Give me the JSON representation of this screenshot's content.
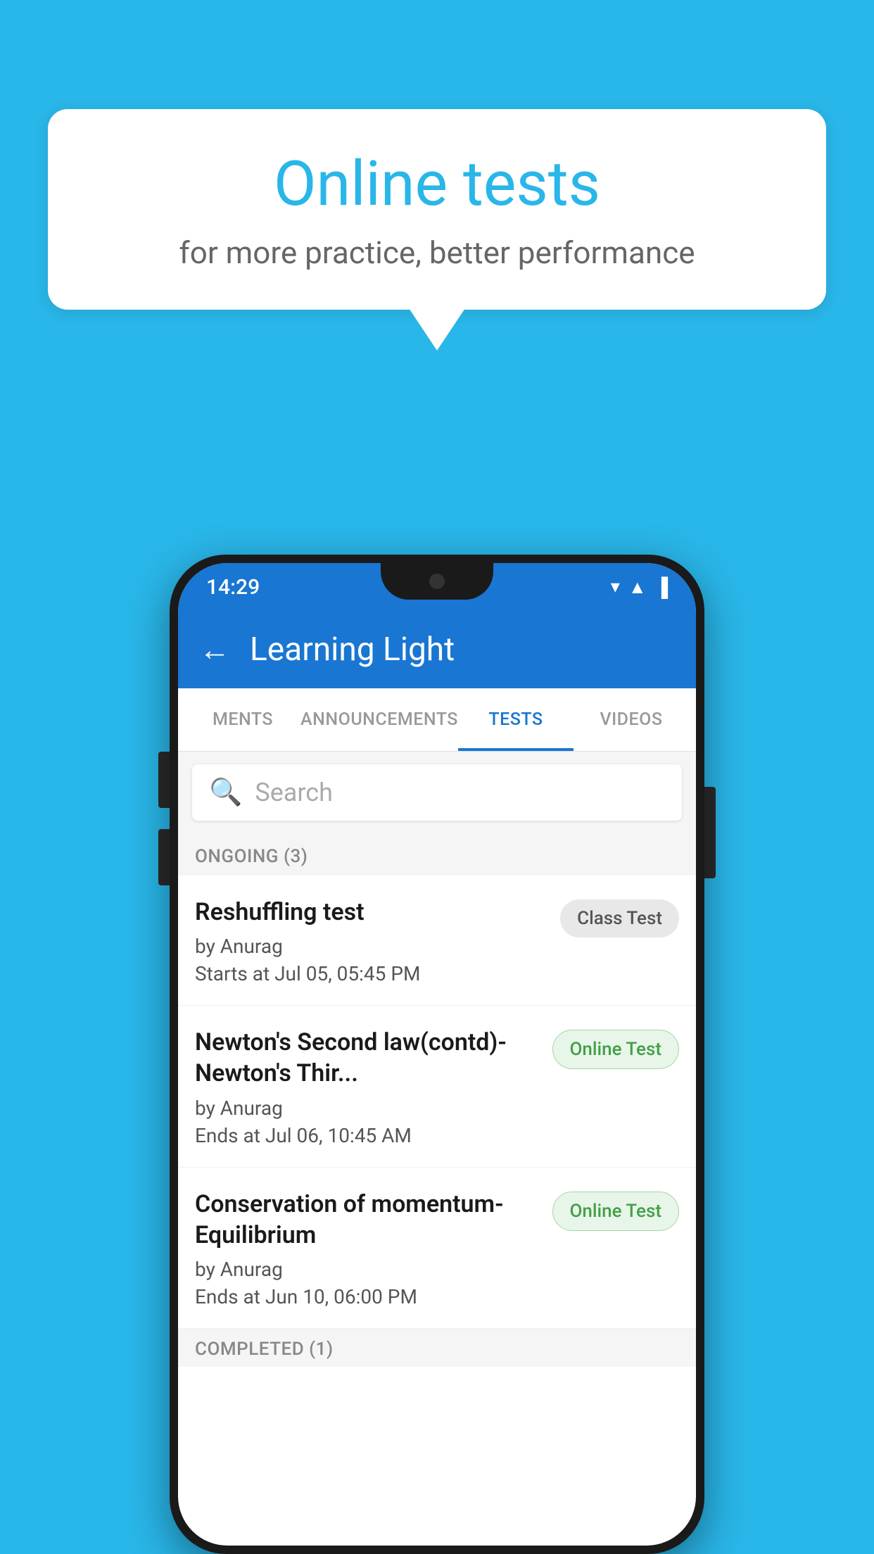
{
  "background": {
    "color": "#29b6e8"
  },
  "speech_bubble": {
    "title": "Online tests",
    "subtitle": "for more practice, better performance"
  },
  "phone": {
    "status_bar": {
      "time": "14:29",
      "icons": [
        "wifi",
        "signal",
        "battery"
      ]
    },
    "app_bar": {
      "back_icon": "←",
      "title": "Learning Light"
    },
    "tabs": [
      {
        "label": "MENTS",
        "active": false
      },
      {
        "label": "ANNOUNCEMENTS",
        "active": false
      },
      {
        "label": "TESTS",
        "active": true
      },
      {
        "label": "VIDEOS",
        "active": false
      }
    ],
    "search": {
      "placeholder": "Search",
      "icon": "🔍"
    },
    "sections": [
      {
        "header": "ONGOING (3)",
        "tests": [
          {
            "title": "Reshuffling test",
            "author": "by Anurag",
            "date": "Starts at  Jul 05, 05:45 PM",
            "badge": "Class Test",
            "badge_type": "class"
          },
          {
            "title": "Newton's Second law(contd)-Newton's Thir...",
            "author": "by Anurag",
            "date": "Ends at  Jul 06, 10:45 AM",
            "badge": "Online Test",
            "badge_type": "online"
          },
          {
            "title": "Conservation of momentum-Equilibrium",
            "author": "by Anurag",
            "date": "Ends at  Jun 10, 06:00 PM",
            "badge": "Online Test",
            "badge_type": "online"
          }
        ]
      }
    ],
    "completed_header": "COMPLETED (1)"
  }
}
